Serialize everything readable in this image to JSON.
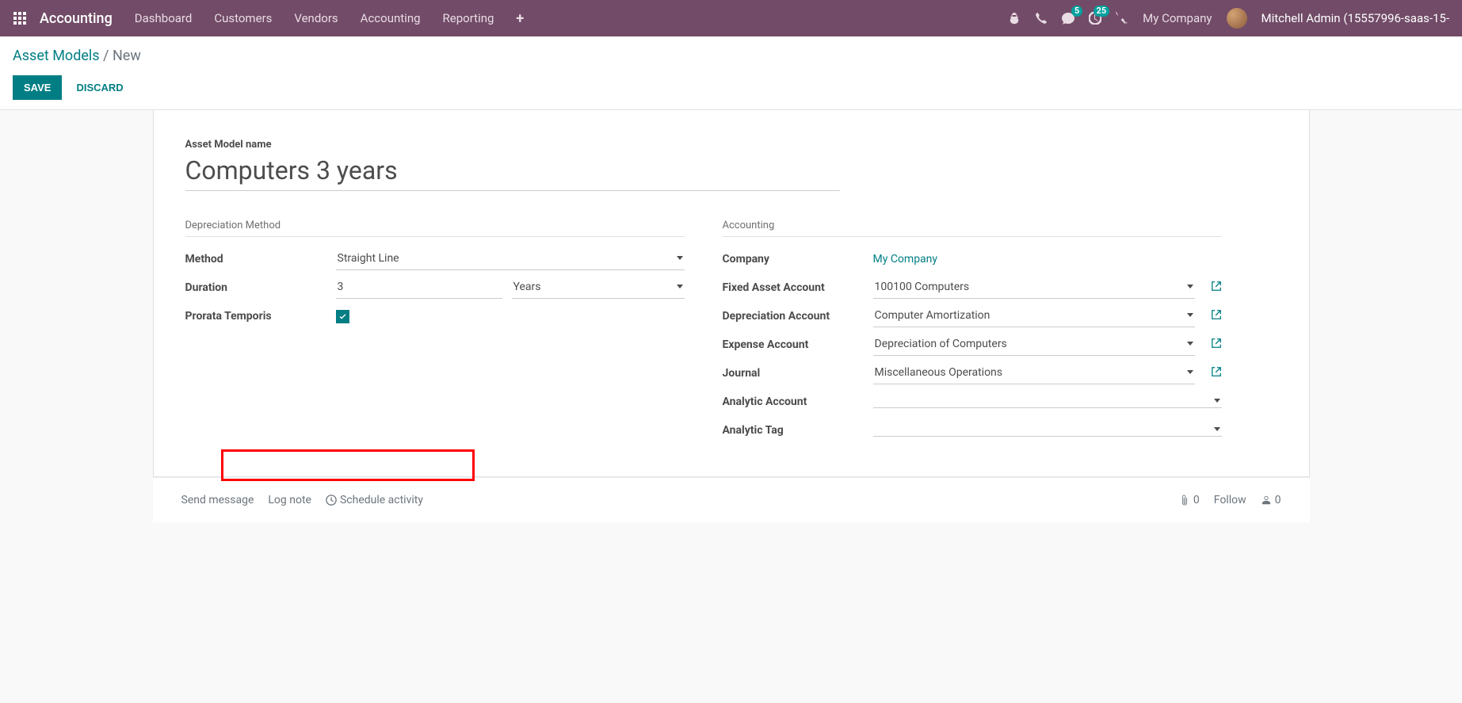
{
  "header": {
    "brand": "Accounting",
    "menu": [
      "Dashboard",
      "Customers",
      "Vendors",
      "Accounting",
      "Reporting"
    ],
    "msg_badge": "5",
    "activity_badge": "25",
    "company": "My Company",
    "user": "Mitchell Admin (15557996-saas-15-"
  },
  "breadcrumb": {
    "root": "Asset Models",
    "current": "New"
  },
  "buttons": {
    "save": "SAVE",
    "discard": "DISCARD"
  },
  "form": {
    "title_label": "Asset Model name",
    "title_value": "Computers 3 years",
    "dep_section": "Depreciation Method",
    "acct_section": "Accounting",
    "labels": {
      "method": "Method",
      "duration": "Duration",
      "prorata": "Prorata Temporis",
      "company": "Company",
      "fixed_asset": "Fixed Asset Account",
      "dep_account": "Depreciation Account",
      "expense_account": "Expense Account",
      "journal": "Journal",
      "analytic_account": "Analytic Account",
      "analytic_tag": "Analytic Tag"
    },
    "values": {
      "method": "Straight Line",
      "duration_num": "3",
      "duration_unit": "Years",
      "company": "My Company",
      "fixed_asset": "100100 Computers",
      "dep_account": "Computer Amortization",
      "expense_account": "Depreciation of Computers",
      "journal": "Miscellaneous Operations"
    }
  },
  "chatter": {
    "send": "Send message",
    "log": "Log note",
    "schedule": "Schedule activity",
    "attach_count": "0",
    "follow": "Follow",
    "follower_count": "0"
  }
}
